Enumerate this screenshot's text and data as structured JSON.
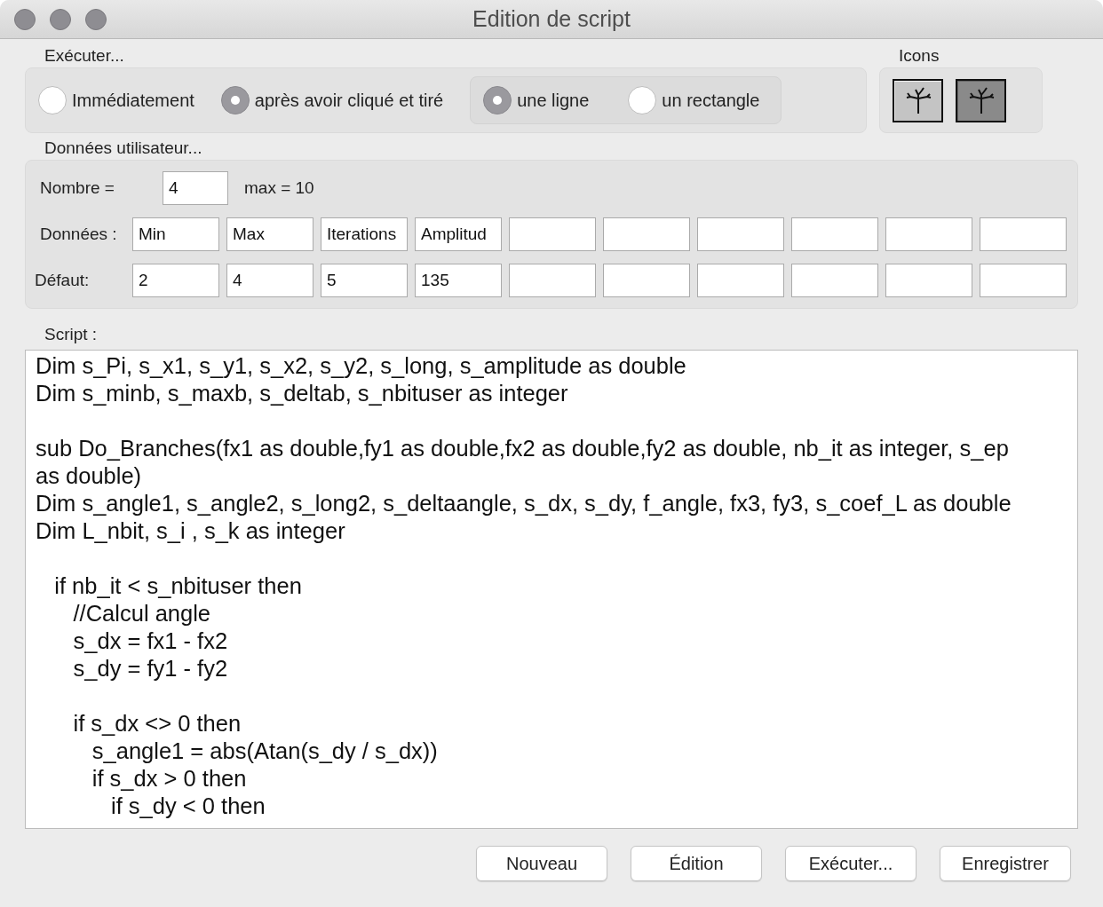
{
  "window": {
    "title": "Edition de script"
  },
  "execute": {
    "label": "Exécuter...",
    "options": [
      {
        "label": "Immédiatement",
        "selected": false
      },
      {
        "label": "après avoir cliqué et tiré",
        "selected": true
      }
    ],
    "shape_options": [
      {
        "label": "une ligne",
        "selected": true
      },
      {
        "label": "un rectangle",
        "selected": false
      }
    ]
  },
  "icons": {
    "label": "Icons",
    "items": [
      {
        "selected": false
      },
      {
        "selected": true
      }
    ]
  },
  "user_data": {
    "label": "Données utilisateur...",
    "count_label": "Nombre =",
    "count_value": "4",
    "max_label": "max = 10",
    "names_label": "Données :",
    "names": [
      "Min",
      "Max",
      "Iterations",
      "Amplitud"
    ],
    "defaults_label": "Défaut:",
    "defaults": [
      "2",
      "4",
      "5",
      "135"
    ]
  },
  "script": {
    "label": "Script :",
    "blocks": [
      {
        "lines": [
          "Dim s_Pi, s_x1, s_y1, s_x2, s_y2, s_long, s_amplitude as double",
          "Dim s_minb, s_maxb, s_deltab, s_nbituser as integer"
        ]
      },
      {
        "lines": [
          "sub Do_Branches(fx1 as double,fy1 as double,fx2 as double,fy2 as double, nb_it as integer, s_ep as double)",
          "Dim s_angle1, s_angle2, s_long2, s_deltaangle, s_dx, s_dy, f_angle, fx3, fy3, s_coef_L as double",
          "Dim L_nbit, s_i , s_k as integer"
        ]
      },
      {
        "lines": [
          "   if nb_it < s_nbituser then",
          "      //Calcul angle",
          "      s_dx = fx1 - fx2",
          "      s_dy = fy1 - fy2"
        ]
      },
      {
        "lines": [
          "      if s_dx <> 0 then",
          "         s_angle1 = abs(Atan(s_dy / s_dx))",
          "         if s_dx > 0 then",
          "            if s_dy < 0 then"
        ]
      }
    ]
  },
  "buttons": [
    "Nouveau",
    "Édition",
    "Exécuter...",
    "Enregistrer"
  ]
}
